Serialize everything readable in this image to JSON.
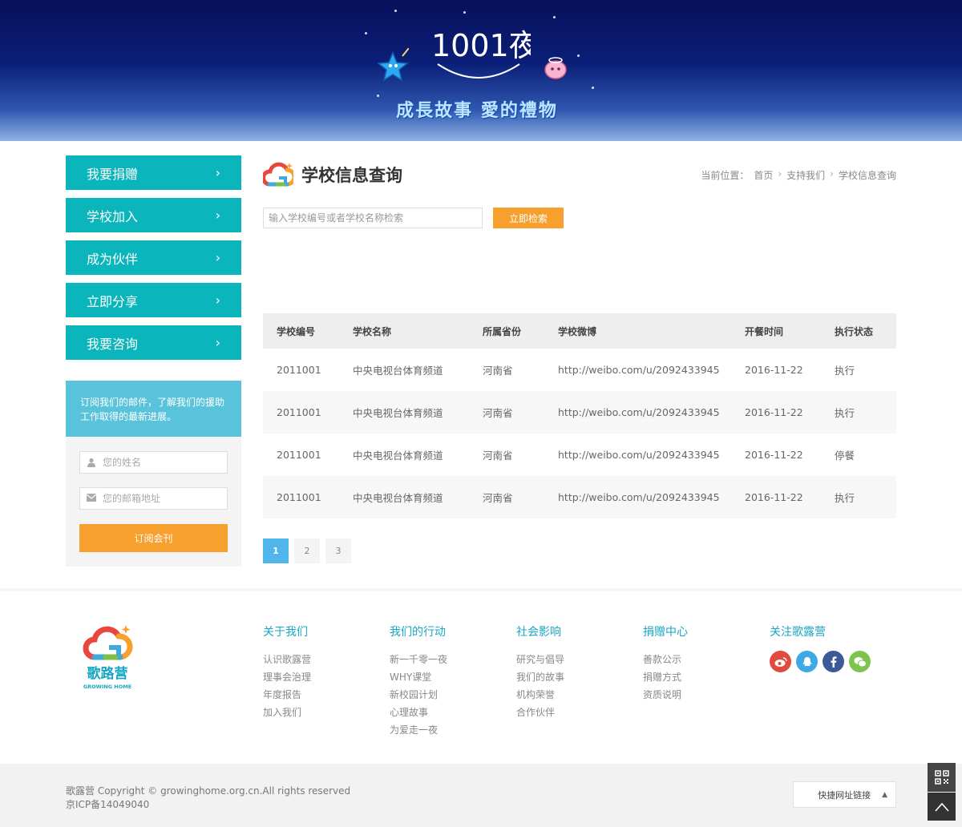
{
  "banner": {
    "logo_text": "1001夜",
    "slogan": "成長故事 愛的禮物"
  },
  "sidebar": {
    "items": [
      {
        "label": "我要捐赠"
      },
      {
        "label": "学校加入"
      },
      {
        "label": "成为伙伴"
      },
      {
        "label": "立即分享"
      },
      {
        "label": "我要咨询"
      }
    ],
    "chevron": "›"
  },
  "subscribe": {
    "intro": "订阅我们的邮件，了解我们的援助工作取得的最新进展。",
    "name_placeholder": "您的姓名",
    "email_placeholder": "您的邮箱地址",
    "button": "订阅会刊"
  },
  "main": {
    "title": "学校信息查询",
    "breadcrumb": {
      "prefix": "当前位置：",
      "items": [
        "首页",
        "支持我们",
        "学校信息查询"
      ],
      "sep": "›"
    },
    "search": {
      "placeholder": "输入学校编号或者学校名称检索",
      "button": "立即检索"
    },
    "table": {
      "headers": [
        "学校编号",
        "学校名称",
        "所属省份",
        "学校微博",
        "开餐时间",
        "执行状态"
      ],
      "rows": [
        [
          "2011001",
          "中央电视台体育频道",
          "河南省",
          "http://weibo.com/u/2092433945",
          "2016-11-22",
          "执行"
        ],
        [
          "2011001",
          "中央电视台体育频道",
          "河南省",
          "http://weibo.com/u/2092433945",
          "2016-11-22",
          "执行"
        ],
        [
          "2011001",
          "中央电视台体育频道",
          "河南省",
          "http://weibo.com/u/2092433945",
          "2016-11-22",
          "停餐"
        ],
        [
          "2011001",
          "中央电视台体育频道",
          "河南省",
          "http://weibo.com/u/2092433945",
          "2016-11-22",
          "执行"
        ]
      ]
    },
    "pager": [
      "1",
      "2",
      "3"
    ]
  },
  "footer": {
    "logo_cn": "歌路营",
    "logo_en": "GROWING HOME",
    "columns": [
      {
        "title": "关于我们",
        "links": [
          "认识歌露营",
          "理事会治理",
          "年度报告",
          "加入我们"
        ]
      },
      {
        "title": "我们的行动",
        "links": [
          "新一千零一夜",
          "WHY课堂",
          "新校园计划",
          "心理故事",
          "为爱走一夜"
        ]
      },
      {
        "title": "社会影响",
        "links": [
          "研究与倡导",
          "我们的故事",
          "机构荣誉",
          "合作伙伴"
        ]
      },
      {
        "title": "捐赠中心",
        "links": [
          "善款公示",
          "捐赠方式",
          "资质说明"
        ]
      }
    ],
    "follow_title": "关注歌露营",
    "copyright": "歌露营 Copyright © growinghome.org.cn.All rights reserved",
    "icp": "京ICP备14049040",
    "quicklinks": "快捷网址链接",
    "quicklinks_arrow": "▲"
  },
  "colors": {
    "teal": "#0ab6bc",
    "orange": "#f7a02d",
    "light_blue": "#59c3db",
    "pager_active": "#4fb5ea",
    "footer_heading": "#1aa6c5"
  }
}
